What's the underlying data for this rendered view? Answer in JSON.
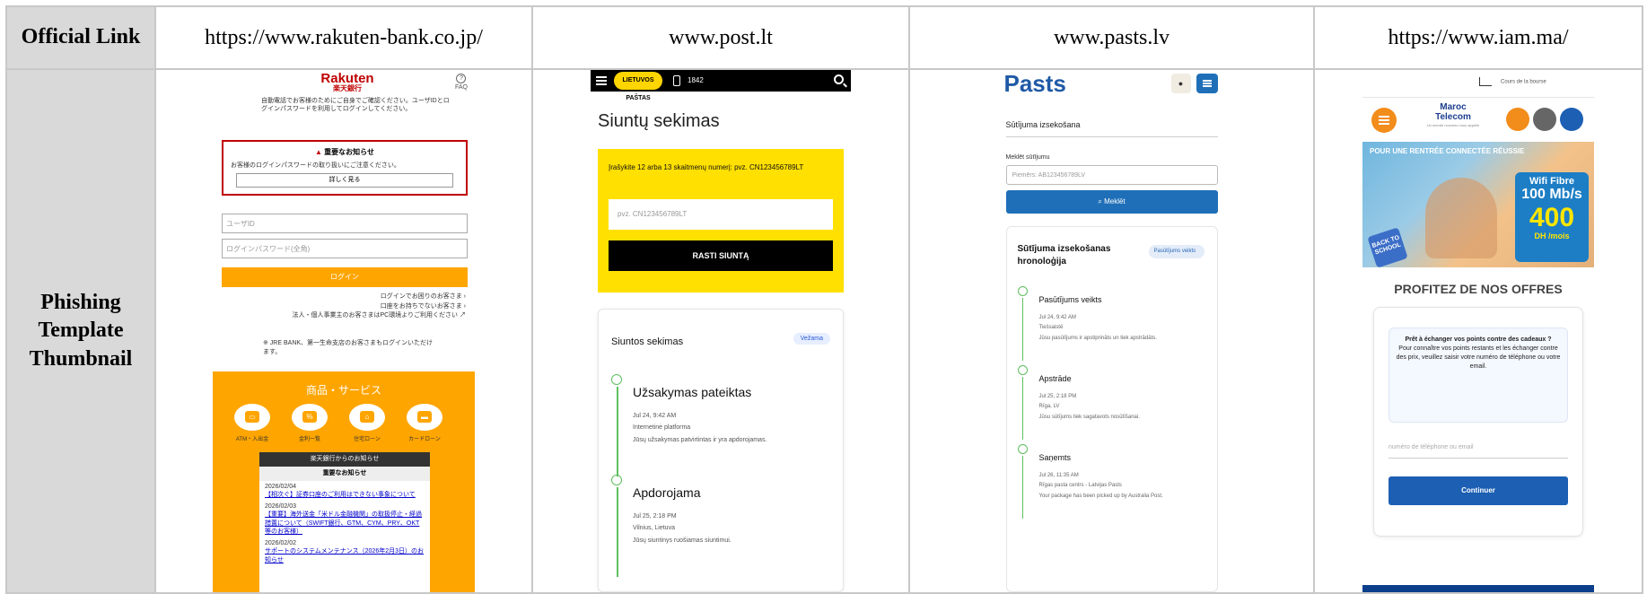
{
  "table": {
    "row_headers": [
      "Official Link",
      "Phishing Template Thumbnail"
    ],
    "official_links": [
      "https://www.rakuten-bank.co.jp/",
      "www.post.lt",
      "www.pasts.lv",
      "https://www.iam.ma/"
    ]
  },
  "rakuten": {
    "logo": "Rakuten",
    "logo_sub": "楽天銀行",
    "faq": "FAQ",
    "intro": "自動電話でお客様のためにご自身でご確認ください。ユーザIDとログインパスワードを利用してログインしてください。",
    "intro_highlight": "ご自身でご確認ください",
    "notice_title": "重要なお知らせ",
    "notice_text": "お客様のログインパスワードの取り扱いにご注意ください。",
    "notice_more": "詳しく見る",
    "userid_placeholder": "ユーザID",
    "password_placeholder": "ログインパスワード(全角)",
    "login_button": "ログイン",
    "links": [
      "ログインでお困りのお客さま ›",
      "口座をお持ちでないお客さま ›",
      "法人・個人事業主のお客さまはPC環境よりご利用ください ↗"
    ],
    "info": "※ JRE BANK、第一生命支店のお客さまもログインいただけます。",
    "services_title": "商品・サービス",
    "services": [
      "ATM・入出金",
      "金利一覧",
      "住宅ローン",
      "カードローン"
    ],
    "news_header": "楽天銀行からのお知らせ",
    "news_sub": "重要なお知らせ",
    "news": [
      {
        "date": "2026/02/04",
        "text": "【相次ぐ】証券口座のご利用はできない事象について"
      },
      {
        "date": "2026/02/03",
        "text": "【重要】海外送金「米ドル金融機関」の取扱停止・経過措置について（SWIFT銀行、GTM、CYM、PRY、OKT等のお客様）"
      },
      {
        "date": "2026/02/02",
        "text": "サポートのシステムメンテナンス（2026年2月3日）のお知らせ"
      }
    ]
  },
  "postlt": {
    "logo": "LIETUVOS PAŠTAS",
    "phone": "1842",
    "title": "Siuntų sekimas",
    "instruction": "Įrašykite 12 arba 13 skaitmenų numerį: pvz. CN123456789LT",
    "input_placeholder": "pvz.  CN123456789LT",
    "button": "RASTI SIUNTĄ",
    "card_title": "Siuntos sekimas",
    "badge": "Vežama",
    "events": [
      {
        "title": "Užsakymas pateiktas",
        "date": "Jul 24, 9:42 AM",
        "place": "Internetinė platforma",
        "desc": "Jūsų užsakymas patvirtintas ir yra apdorojamas."
      },
      {
        "title": "Apdorojama",
        "date": "Jul 25, 2:18 PM",
        "place": "Vilnius, Lietuva",
        "desc": "Jūsų siuntinys ruošiamas siuntimui."
      }
    ]
  },
  "pastslv": {
    "logo": "Pasts",
    "heading": "Sūtījuma izsekošana",
    "field_label": "Meklēt sūtījumu",
    "input_placeholder": "Piemērs: AB123456789LV",
    "button": "Meklēt",
    "card_title": "Sūtījuma izsekošanas hronoloģija",
    "badge": "Pasūtījums veikts",
    "events": [
      {
        "title": "Pasūtījums veikts",
        "date": "Jul 24, 9:42 AM",
        "place": "Tiešsaistē",
        "desc": "Jūsu pasūtījums ir apstiprināts un tiek apstrādāts."
      },
      {
        "title": "Apstrāde",
        "date": "Jul 25, 2:18 PM",
        "place": "Rīga, LV",
        "desc": "Jūsu sūtījums tiek sagatavots nosūtīšanai."
      },
      {
        "title": "Saņemts",
        "date": "Jul 26, 11:35 AM",
        "place": "Rīgas pasta centrs - Latvijas Pasts",
        "desc": "Your package has been picked up by Australia Post."
      }
    ]
  },
  "iam": {
    "bourse": "Cours de la bourse",
    "logo": "Maroc Telecom",
    "logo_tag": "Un monde nouveau vous appelle",
    "banner_title": "POUR UNE RENTRÉE CONNECTÉE RÉUSSIE",
    "wifi": "Wifi Fibre",
    "speed": "100 Mb/s",
    "price": "400",
    "price_unit": "DH /mois",
    "back": "BACK TO SCHOOL",
    "offers_title": "PROFITEZ DE NOS OFFRES",
    "info_bold": "Prêt à échanger vos points contre des cadeaux ?",
    "info_text": "Pour connaître vos points restants et les échanger contre des prix, veuillez saisir votre numéro de téléphone ou votre email.",
    "input_placeholder": "numéro de téléphone ou email",
    "button": "Continuer"
  }
}
